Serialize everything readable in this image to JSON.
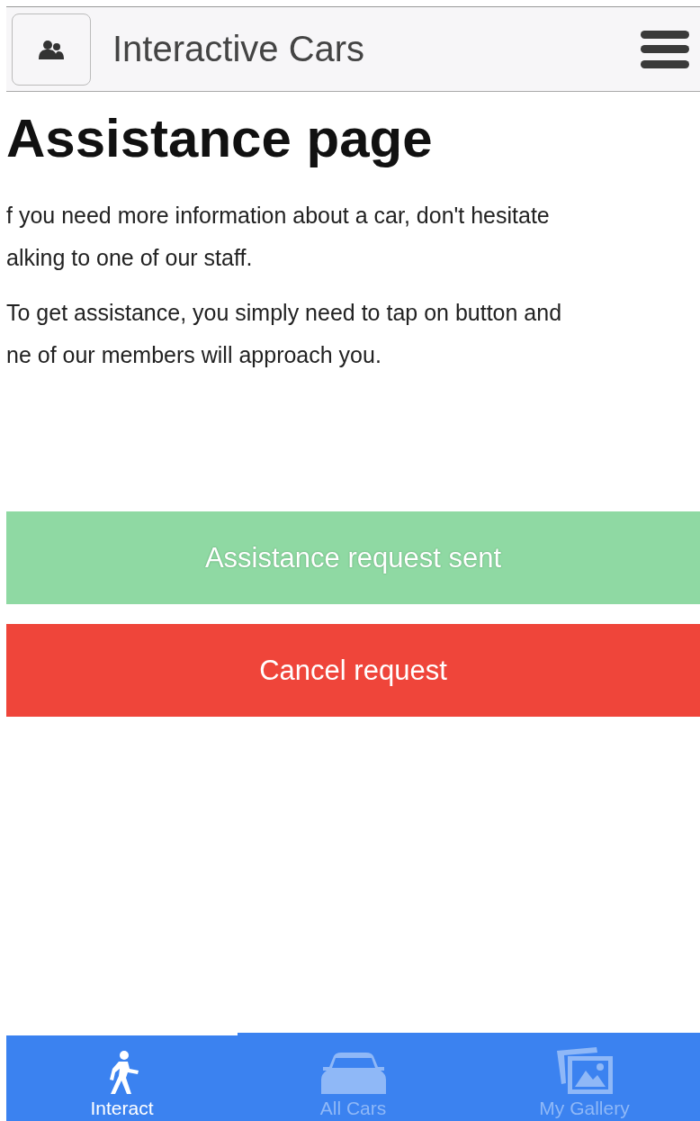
{
  "header": {
    "title": "Interactive Cars"
  },
  "page": {
    "heading": "Assistance page",
    "paragraphs": [
      [
        "f you need more information about a car, don't hesitate",
        "alking to one of our staff."
      ],
      [
        "To get assistance, you simply need to tap on button and",
        "ne of our members will approach you."
      ]
    ]
  },
  "buttons": [
    {
      "label": "Assistance request sent",
      "kind": "success",
      "disabled": true
    },
    {
      "label": "Cancel request",
      "kind": "danger",
      "disabled": false
    }
  ],
  "tabs": [
    {
      "label": "Interact",
      "kind": "walk",
      "selected": true
    },
    {
      "label": "All Cars",
      "kind": "car",
      "selected": false
    },
    {
      "label": "My Gallery",
      "kind": "gallery",
      "selected": false
    }
  ]
}
